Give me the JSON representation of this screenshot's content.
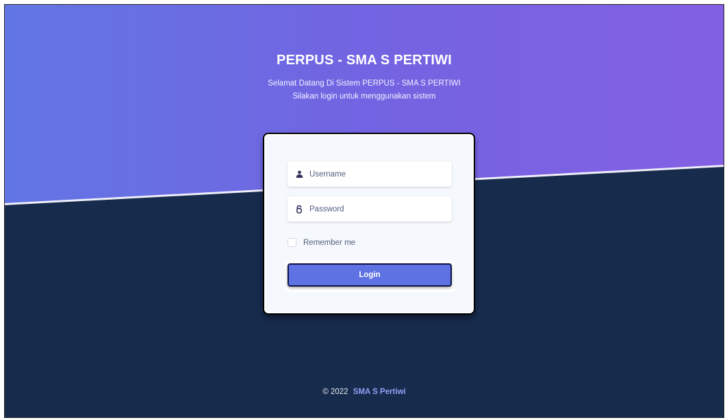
{
  "header": {
    "title": "PERPUS - SMA S PERTIWI",
    "welcome": "Selamat Datang Di Sistem PERPUS - SMA S PERTIWI",
    "instruction": "Silakan login untuk menggunakan sistem"
  },
  "login_form": {
    "username": {
      "placeholder": "Username",
      "value": "",
      "icon": "user-icon"
    },
    "password": {
      "placeholder": "Password",
      "value": "",
      "icon": "lock-icon"
    },
    "remember_label": "Remember me",
    "remember_checked": false,
    "submit_label": "Login"
  },
  "footer": {
    "copyright": "© 2022",
    "brand": "SMA S Pertiwi"
  },
  "colors": {
    "gradient_start": "#6276e3",
    "gradient_end": "#8360e3",
    "background_dark": "#172b4d",
    "button_primary": "#5e72e4",
    "brand_link": "#8fa1f5"
  }
}
